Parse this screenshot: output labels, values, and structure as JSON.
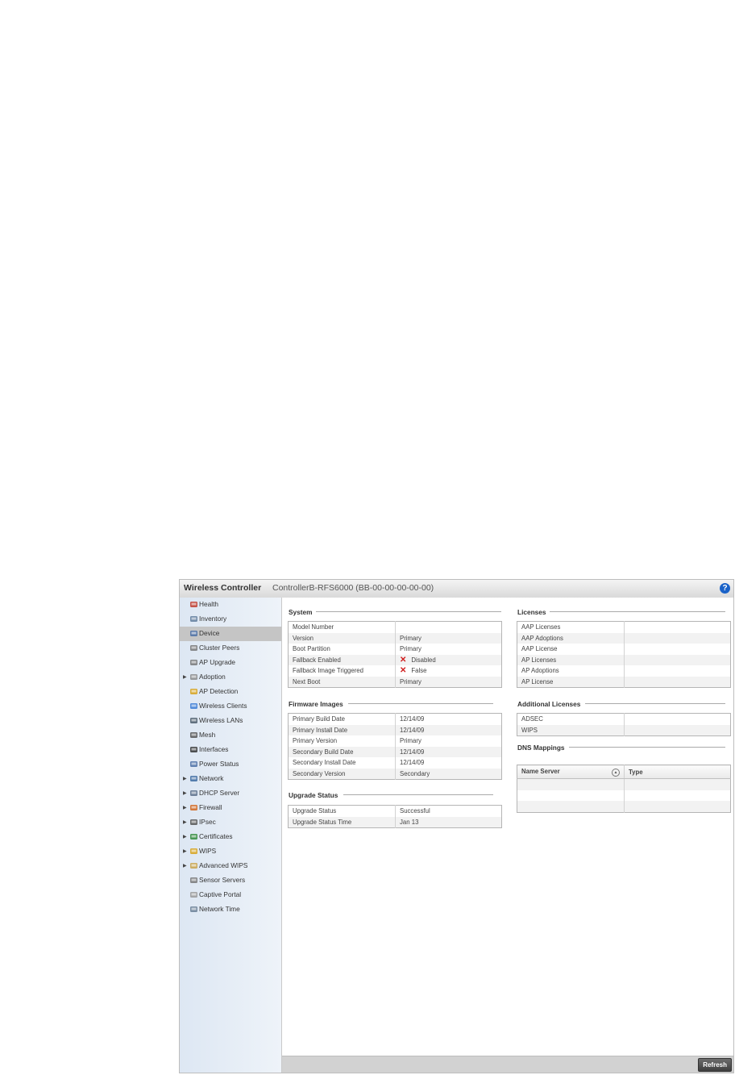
{
  "window": {
    "app_name": "Wireless Controller",
    "device_id": "ControllerB-RFS6000 (BB-00-00-00-00-00)",
    "help_glyph": "?"
  },
  "sidebar": {
    "items": [
      {
        "label": "Health",
        "icon": "health-icon",
        "expandable": false,
        "selected": false
      },
      {
        "label": "Inventory",
        "icon": "inventory-icon",
        "expandable": false,
        "selected": false
      },
      {
        "label": "Device",
        "icon": "device-icon",
        "expandable": false,
        "selected": true
      },
      {
        "label": "Cluster Peers",
        "icon": "cluster-peers-icon",
        "expandable": false,
        "selected": false
      },
      {
        "label": "AP Upgrade",
        "icon": "ap-upgrade-icon",
        "expandable": false,
        "selected": false
      },
      {
        "label": "Adoption",
        "icon": "adoption-icon",
        "expandable": true,
        "selected": false
      },
      {
        "label": "AP Detection",
        "icon": "ap-detection-icon",
        "expandable": false,
        "selected": false
      },
      {
        "label": "Wireless Clients",
        "icon": "wireless-clients-icon",
        "expandable": false,
        "selected": false
      },
      {
        "label": "Wireless LANs",
        "icon": "wireless-lans-icon",
        "expandable": false,
        "selected": false
      },
      {
        "label": "Mesh",
        "icon": "mesh-icon",
        "expandable": false,
        "selected": false
      },
      {
        "label": "Interfaces",
        "icon": "interfaces-icon",
        "expandable": false,
        "selected": false
      },
      {
        "label": "Power Status",
        "icon": "power-status-icon",
        "expandable": false,
        "selected": false
      },
      {
        "label": "Network",
        "icon": "network-icon",
        "expandable": true,
        "selected": false
      },
      {
        "label": "DHCP Server",
        "icon": "dhcp-server-icon",
        "expandable": true,
        "selected": false
      },
      {
        "label": "Firewall",
        "icon": "firewall-icon",
        "expandable": true,
        "selected": false
      },
      {
        "label": "IPsec",
        "icon": "ipsec-icon",
        "expandable": true,
        "selected": false
      },
      {
        "label": "Certificates",
        "icon": "certificates-icon",
        "expandable": true,
        "selected": false
      },
      {
        "label": "WIPS",
        "icon": "wips-icon",
        "expandable": true,
        "selected": false
      },
      {
        "label": "Advanced WIPS",
        "icon": "advanced-wips-icon",
        "expandable": true,
        "selected": false
      },
      {
        "label": "Sensor Servers",
        "icon": "sensor-servers-icon",
        "expandable": false,
        "selected": false
      },
      {
        "label": "Captive Portal",
        "icon": "captive-portal-icon",
        "expandable": false,
        "selected": false
      },
      {
        "label": "Network Time",
        "icon": "network-time-icon",
        "expandable": false,
        "selected": false
      }
    ]
  },
  "system": {
    "title": "System",
    "rows": [
      {
        "label": "Model Number",
        "value": ""
      },
      {
        "label": "Version",
        "value": "Primary"
      },
      {
        "label": "Boot Partition",
        "value": "Primary"
      },
      {
        "label": "Fallback Enabled",
        "value": "Disabled",
        "x": true
      },
      {
        "label": "Fallback Image Triggered",
        "value": "False",
        "x": true
      },
      {
        "label": "Next Boot",
        "value": "Primary"
      }
    ]
  },
  "firmware": {
    "title": "Firmware Images",
    "rows": [
      {
        "label": "Primary Build Date",
        "value": "12/14/09"
      },
      {
        "label": "Primary Install Date",
        "value": "12/14/09"
      },
      {
        "label": "Primary Version",
        "value": "Primary"
      },
      {
        "label": "Secondary Build Date",
        "value": "12/14/09"
      },
      {
        "label": "Secondary Install Date",
        "value": "12/14/09"
      },
      {
        "label": "Secondary Version",
        "value": "Secondary"
      }
    ]
  },
  "upgrade": {
    "title": "Upgrade Status",
    "rows": [
      {
        "label": "Upgrade Status",
        "value": "Successful"
      },
      {
        "label": "Upgrade Status Time",
        "value": "Jan 13"
      }
    ]
  },
  "licenses": {
    "title": "Licenses",
    "rows": [
      {
        "label": "AAP Licenses",
        "value": ""
      },
      {
        "label": "AAP Adoptions",
        "value": ""
      },
      {
        "label": "AAP License",
        "value": ""
      },
      {
        "label": "AP Licenses",
        "value": ""
      },
      {
        "label": "AP Adoptions",
        "value": ""
      },
      {
        "label": "AP License",
        "value": ""
      }
    ]
  },
  "additional_licenses": {
    "title": "Additional Licenses",
    "rows": [
      {
        "label": "ADSEC",
        "value": ""
      },
      {
        "label": "WIPS",
        "value": ""
      }
    ]
  },
  "dns": {
    "title": "DNS Mappings",
    "columns": [
      "Name Server",
      "Type"
    ],
    "empty_rows": 3
  },
  "footer": {
    "refresh_label": "Refresh"
  }
}
